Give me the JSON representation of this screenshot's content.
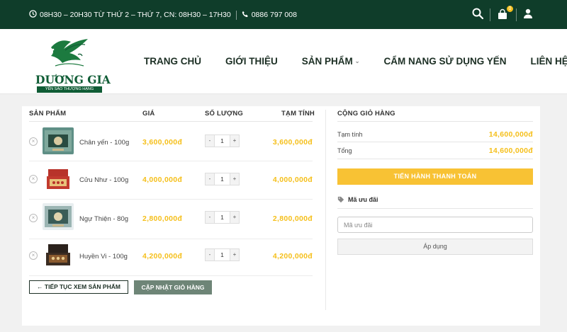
{
  "topbar": {
    "hours": "08H30 – 20H30 TỪ THỨ 2 – THỨ 7, CN: 08H30 – 17H30",
    "phone": "0886 797 008",
    "cart_count": "0"
  },
  "header": {
    "brand_name": "DƯƠNG GIA",
    "brand_slogan": "YẾN SÀO THƯỢNG HẠNG",
    "nav": [
      "TRANG CHỦ",
      "GIỚI THIỆU",
      "SẢN PHẨM",
      "CẨM NANG SỬ DỤNG YẾN",
      "LIÊN HỆ"
    ]
  },
  "cart": {
    "headers": {
      "product": "SẢN PHẨM",
      "price": "GIÁ",
      "quantity": "SỐ LƯỢNG",
      "subtotal": "TẠM TÍNH"
    },
    "items": [
      {
        "name": "Chân yến - 100g",
        "price": "3,600,000đ",
        "qty": "1",
        "subtotal": "3,600,000đ",
        "minus": "-",
        "plus": "+",
        "remove": "×"
      },
      {
        "name": "Cửu Như - 100g",
        "price": "4,000,000đ",
        "qty": "1",
        "subtotal": "4,000,000đ",
        "minus": "-",
        "plus": "+",
        "remove": "×"
      },
      {
        "name": "Ngự Thiện - 80g",
        "price": "2,800,000đ",
        "qty": "1",
        "subtotal": "2,800,000đ",
        "minus": "-",
        "plus": "+",
        "remove": "×"
      },
      {
        "name": "Huyền Vi - 100g",
        "price": "4,200,000đ",
        "qty": "1",
        "subtotal": "4,200,000đ",
        "minus": "-",
        "plus": "+",
        "remove": "×"
      }
    ],
    "continue_label": "← TIẾP TỤC XEM SẢN PHẨM",
    "update_label": "CẬP NHẬT GIỎ HÀNG"
  },
  "totals": {
    "title": "CỘNG GIỎ HÀNG",
    "subtotal_label": "Tạm tính",
    "subtotal_value": "14,600,000đ",
    "total_label": "Tổng",
    "total_value": "14,600,000đ",
    "checkout_label": "TIẾN HÀNH THANH TOÁN",
    "coupon_title": "Mã ưu đãi",
    "coupon_placeholder": "Mã ưu đãi",
    "apply_label": "Áp dụng"
  },
  "colors": {
    "topbar": "#0f3d2a",
    "brand_green": "#0f5c35",
    "price_gold": "#f5bf1a",
    "checkout": "#f8c234",
    "update_button": "#6e8577"
  },
  "icons": [
    "clock-icon",
    "phone-icon",
    "search-icon",
    "cart-icon",
    "user-icon",
    "bird-logo-icon",
    "tag-icon",
    "remove-icon"
  ]
}
